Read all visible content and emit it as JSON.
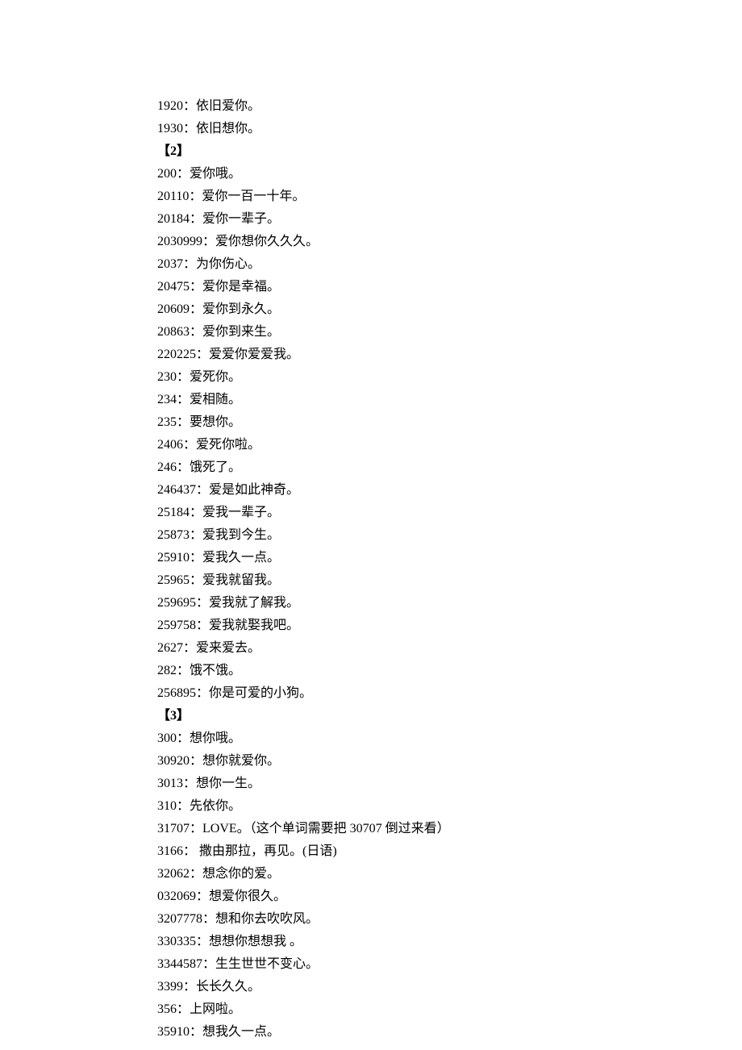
{
  "lines": [
    {
      "text": "1920：依旧爱你。",
      "header": false
    },
    {
      "text": "1930：依旧想你。",
      "header": false
    },
    {
      "text": "【2】",
      "header": true
    },
    {
      "text": "200：爱你哦。",
      "header": false
    },
    {
      "text": "20110：爱你一百一十年。",
      "header": false
    },
    {
      "text": "20184：爱你一辈子。",
      "header": false
    },
    {
      "text": "2030999：爱你想你久久久。",
      "header": false
    },
    {
      "text": "2037：为你伤心。",
      "header": false
    },
    {
      "text": "20475：爱你是幸福。",
      "header": false
    },
    {
      "text": "20609：爱你到永久。",
      "header": false
    },
    {
      "text": "20863：爱你到来生。",
      "header": false
    },
    {
      "text": "220225：爱爱你爱爱我。",
      "header": false
    },
    {
      "text": "230：爱死你。",
      "header": false
    },
    {
      "text": "234：爱相随。",
      "header": false
    },
    {
      "text": "235：要想你。",
      "header": false
    },
    {
      "text": "2406：爱死你啦。",
      "header": false
    },
    {
      "text": "246：饿死了。",
      "header": false
    },
    {
      "text": "246437：爱是如此神奇。",
      "header": false
    },
    {
      "text": "25184：爱我一辈子。",
      "header": false
    },
    {
      "text": "25873：爱我到今生。",
      "header": false
    },
    {
      "text": "25910：爱我久一点。",
      "header": false
    },
    {
      "text": "25965：爱我就留我。",
      "header": false
    },
    {
      "text": "259695：爱我就了解我。",
      "header": false
    },
    {
      "text": "259758：爱我就娶我吧。",
      "header": false
    },
    {
      "text": "2627：爱来爱去。",
      "header": false
    },
    {
      "text": "282：饿不饿。",
      "header": false
    },
    {
      "text": "256895：你是可爱的小狗。",
      "header": false
    },
    {
      "text": "【3】",
      "header": true
    },
    {
      "text": "300：想你哦。",
      "header": false
    },
    {
      "text": "30920：想你就爱你。",
      "header": false
    },
    {
      "text": "3013：想你一生。",
      "header": false
    },
    {
      "text": "310：先依你。",
      "header": false
    },
    {
      "text": "31707：LOVE。（这个单词需要把 30707 倒过来看）",
      "header": false
    },
    {
      "text": "3166： 撒由那拉，再见。(日语)",
      "header": false
    },
    {
      "text": "32062：想念你的爱。",
      "header": false
    },
    {
      "text": "032069：想爱你很久。",
      "header": false
    },
    {
      "text": "3207778：想和你去吹吹风。",
      "header": false
    },
    {
      "text": "330335：想想你想想我 。",
      "header": false
    },
    {
      "text": "3344587：生生世世不变心。",
      "header": false
    },
    {
      "text": "3399：长长久久。",
      "header": false
    },
    {
      "text": "356：上网啦。",
      "header": false
    },
    {
      "text": "35910：想我久一点。",
      "header": false
    }
  ]
}
